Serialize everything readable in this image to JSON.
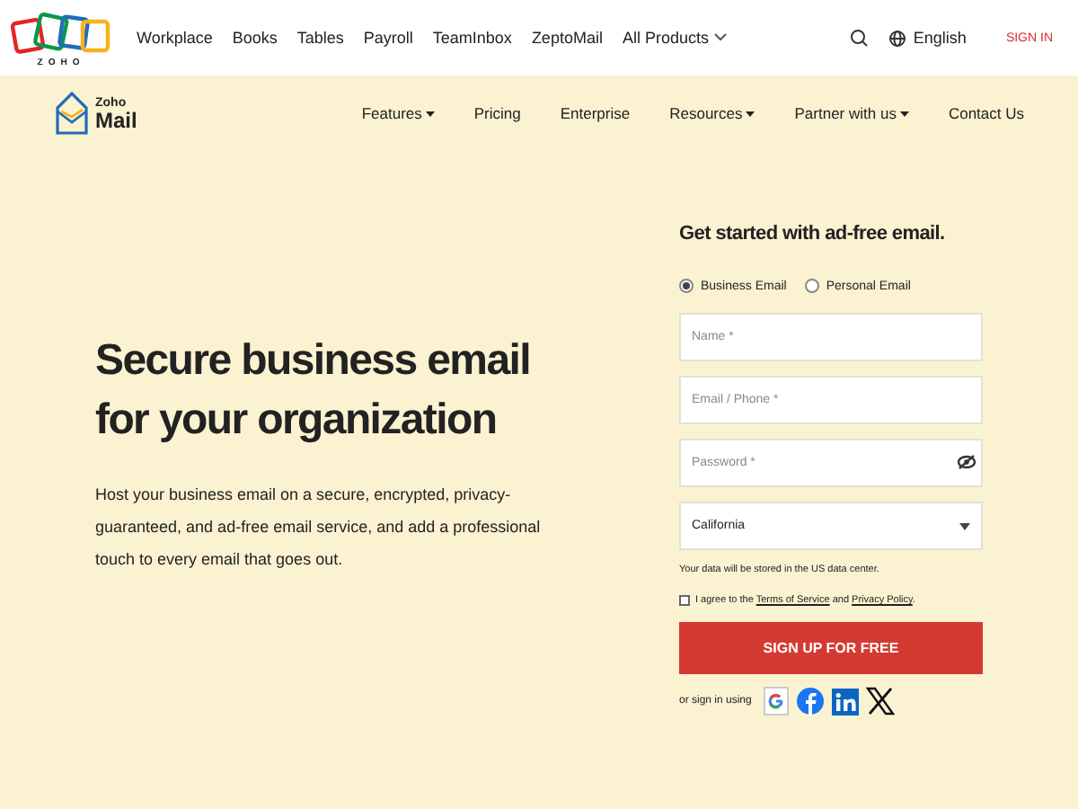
{
  "top_bar": {
    "logo_caption": "ZOHO",
    "links": [
      {
        "label": "Workplace"
      },
      {
        "label": "Books"
      },
      {
        "label": "Tables"
      },
      {
        "label": "Payroll"
      },
      {
        "label": "TeamInbox"
      },
      {
        "label": "ZeptoMail"
      },
      {
        "label": "All Products",
        "dropdown": true
      }
    ],
    "language": "English",
    "sign_in": "SIGN IN"
  },
  "product_nav": {
    "brand_top": "Zoho",
    "brand_name": "Mail",
    "items": [
      {
        "label": "Features",
        "dropdown": true
      },
      {
        "label": "Pricing",
        "dropdown": false
      },
      {
        "label": "Enterprise",
        "dropdown": false
      },
      {
        "label": "Resources",
        "dropdown": true
      },
      {
        "label": "Partner with us",
        "dropdown": true
      },
      {
        "label": "Contact Us",
        "dropdown": false
      }
    ]
  },
  "hero": {
    "heading": "Secure business email for your organization",
    "description": "Host your business email on a secure, encrypted, privacy-guaranteed, and ad-free email service, and add a professional touch to every email that goes out."
  },
  "signup_form": {
    "title": "Get started with ad-free email.",
    "account_types": [
      {
        "label": "Business Email",
        "selected": true
      },
      {
        "label": "Personal Email",
        "selected": false
      }
    ],
    "fields": [
      {
        "kind": "text",
        "placeholder": "Name *"
      },
      {
        "kind": "text",
        "placeholder": "Email / Phone *"
      },
      {
        "kind": "password",
        "placeholder": "Password *"
      },
      {
        "kind": "select",
        "value": "California"
      }
    ],
    "data_note": "Your data will be stored in the US data center.",
    "consent": {
      "checked": false,
      "parts": [
        {
          "kind": "text",
          "text": "I agree to the "
        },
        {
          "kind": "link",
          "text": "Terms of Service"
        },
        {
          "kind": "text",
          "text": " and "
        },
        {
          "kind": "link",
          "text": "Privacy Policy"
        },
        {
          "kind": "text",
          "text": "."
        }
      ]
    },
    "submit": "SIGN UP FOR FREE",
    "social_label": "or sign in using",
    "social": [
      {
        "kind": "google"
      },
      {
        "kind": "facebook"
      },
      {
        "kind": "linkedin"
      },
      {
        "kind": "x"
      }
    ]
  }
}
